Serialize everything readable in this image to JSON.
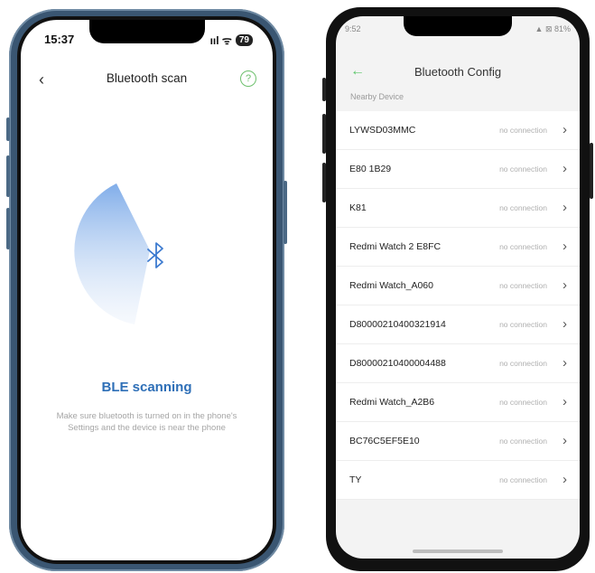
{
  "left_phone": {
    "status_time": "15:37",
    "status_icons": "ııl ᯤ",
    "battery": "79",
    "nav_back": "‹",
    "nav_title": "Bluetooth scan",
    "help_label": "?",
    "bluetooth_glyph": "ᛒ",
    "scanning_label": "BLE scanning",
    "hint_line1": "Make sure bluetooth is turned on in the phone's",
    "hint_line2": "Settings and the device is near the phone",
    "accent_color": "#2e6fb7"
  },
  "right_phone": {
    "status_time": "9:52",
    "status_icons": "▲ ⊠ 81%",
    "nav_back": "←",
    "nav_title": "Bluetooth Config",
    "section_label": "Nearby Device",
    "devices": [
      {
        "name": "LYWSD03MMC",
        "state": "no connection"
      },
      {
        "name": "E80 1B29",
        "state": "no connection"
      },
      {
        "name": "K81",
        "state": "no connection"
      },
      {
        "name": "Redmi Watch 2 E8FC",
        "state": "no connection"
      },
      {
        "name": "Redmi Watch_A060",
        "state": "no connection"
      },
      {
        "name": "D80000210400321914",
        "state": "no connection"
      },
      {
        "name": "D80000210400004488",
        "state": "no connection"
      },
      {
        "name": "Redmi Watch_A2B6",
        "state": "no connection"
      },
      {
        "name": "BC76C5EF5E10",
        "state": "no connection"
      },
      {
        "name": "TY",
        "state": "no connection"
      }
    ],
    "chevron": "›",
    "accent_color": "#5bc76a"
  }
}
